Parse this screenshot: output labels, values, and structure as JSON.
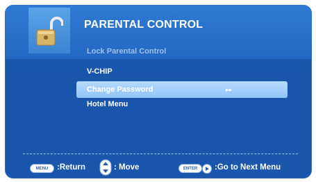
{
  "title": "PARENTAL CONTROL",
  "menu": {
    "items": [
      {
        "label": "Lock Parental Control",
        "state": "disabled"
      },
      {
        "label": "V-CHIP",
        "state": "normal"
      },
      {
        "label": "Change Password",
        "state": "selected",
        "submenu_indicator": "▸▸"
      },
      {
        "label": "Hotel Menu",
        "state": "normal"
      }
    ]
  },
  "footer": {
    "menu_key": "MENU",
    "return_label": ":Return",
    "move_label": ": Move",
    "enter_key": "ENTER",
    "next_label": ":Go to Next Menu"
  },
  "colors": {
    "panel": "#1a56ad",
    "header": "#2f7ad3",
    "selection": "#a3d0fc"
  }
}
